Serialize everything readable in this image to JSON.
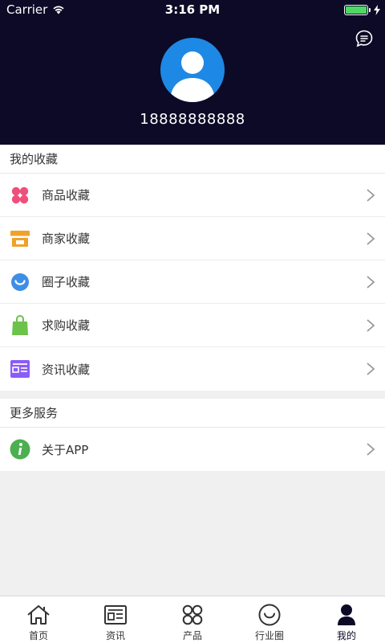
{
  "status_bar": {
    "carrier": "Carrier",
    "time": "3:16 PM"
  },
  "profile": {
    "phone": "18888888888"
  },
  "favorites": {
    "title": "我的收藏",
    "items": [
      {
        "label": "商品收藏",
        "icon": "clover-icon"
      },
      {
        "label": "商家收藏",
        "icon": "shop-icon"
      },
      {
        "label": "圈子收藏",
        "icon": "smile-circle-icon"
      },
      {
        "label": "求购收藏",
        "icon": "shopping-bag-icon"
      },
      {
        "label": "资讯收藏",
        "icon": "news-card-icon"
      }
    ]
  },
  "more": {
    "title": "更多服务",
    "items": [
      {
        "label": "关于APP",
        "icon": "info-icon"
      }
    ]
  },
  "tabbar": {
    "items": [
      {
        "label": "首页",
        "icon": "home-icon"
      },
      {
        "label": "资讯",
        "icon": "news-icon"
      },
      {
        "label": "产品",
        "icon": "product-icon"
      },
      {
        "label": "行业圈",
        "icon": "circle-icon"
      },
      {
        "label": "我的",
        "icon": "user-icon"
      }
    ],
    "active_index": 4
  },
  "colors": {
    "header_bg": "#0c0a26",
    "avatar_bg": "#1e88e5",
    "battery": "#4cd964",
    "clover": "#ef4f7a",
    "shop": "#f0a12a",
    "smile": "#3d8ee6",
    "bag": "#6cc24a",
    "news": "#8b5cf6",
    "info": "#4caf50"
  }
}
